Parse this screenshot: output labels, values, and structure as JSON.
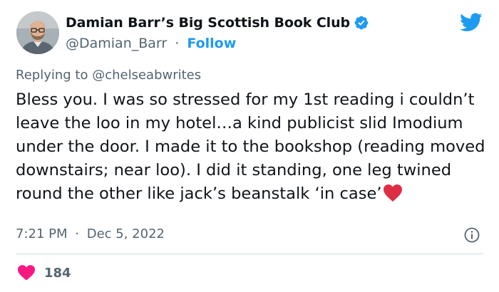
{
  "author": {
    "display_name": "Damian Barr’s Big Scottish Book Club",
    "handle": "@Damian_Barr",
    "separator": "·",
    "follow_label": "Follow",
    "verified": true
  },
  "reply": {
    "prefix": "Replying to ",
    "to_handle": "@chelseabwrites"
  },
  "tweet": {
    "text": "Bless you. I was so stressed for my 1st reading i couldn’t leave the loo in my hotel…a kind publicist slid Imodium under the door. I made it to the bookshop (reading moved downstairs; near loo). I did it standing, one leg twined round the other like jack’s beanstalk ‘in case’",
    "emoji": "red-heart"
  },
  "meta": {
    "time": "7:21 PM",
    "separator": "·",
    "date": "Dec 5, 2022"
  },
  "engagement": {
    "likes": "184"
  },
  "colors": {
    "accent": "#1d9bf0",
    "text": "#0f1419",
    "secondary": "#536471",
    "like": "#f91880",
    "divider": "#cfd9de"
  },
  "icons": [
    "verified-badge-icon",
    "twitter-bird-icon",
    "info-icon",
    "heart-icon",
    "red-heart-emoji"
  ]
}
